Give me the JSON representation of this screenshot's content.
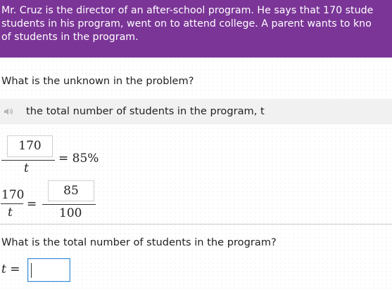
{
  "problem": {
    "line1": "Mr. Cruz is the director of an after-school program. He says that 170 stude",
    "line2": "students in his program, went on to attend college. A parent wants to kno",
    "line3": "of students in the program."
  },
  "question1": "What is the unknown in the problem?",
  "answer1": {
    "icon": "speaker-icon",
    "text": "the total number of students in the program, t"
  },
  "equation1": {
    "numerator": "170",
    "denominator": "t",
    "rhs": "= 85%"
  },
  "equation2": {
    "left_numerator": "170",
    "left_denominator": "t",
    "equals": "=",
    "right_numerator": "85",
    "right_denominator": "100"
  },
  "question2": "What is the total number of students in the program?",
  "answer_input": {
    "label": "t =",
    "value": ""
  },
  "colors": {
    "banner": "#7b3597",
    "input_border": "#3b8ed8"
  }
}
